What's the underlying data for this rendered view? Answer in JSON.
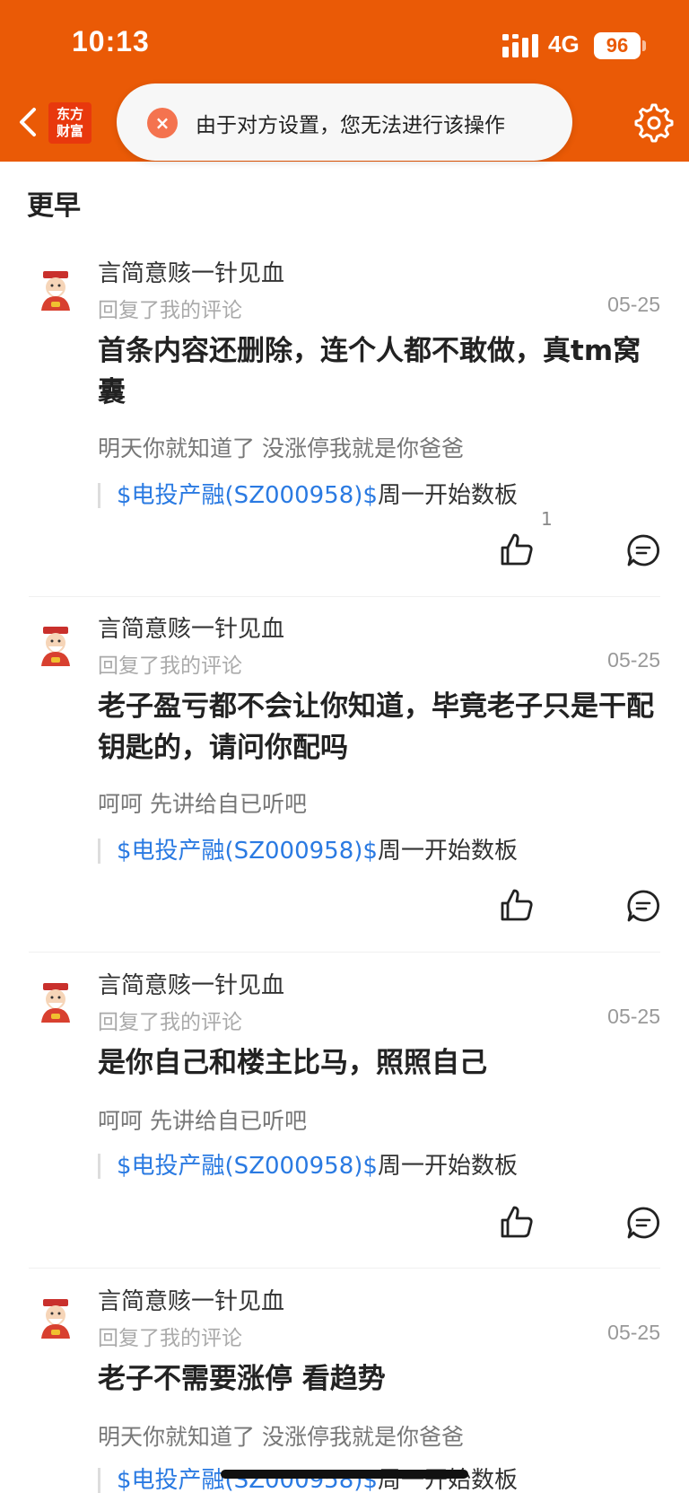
{
  "status_bar": {
    "time": "10:13",
    "network": "4G",
    "battery": "96"
  },
  "header": {
    "logo_line1": "东方",
    "logo_line2": "财富",
    "toast_text": "由于对方设置，您无法进行该操作"
  },
  "section_title": "更早",
  "items": [
    {
      "author": "言简意赅一针见血",
      "action": "回复了我的评论",
      "date": "05-25",
      "content": "首条内容还删除，连个人都不敢做，真tm窝囊",
      "quote": "明天你就知道了 没涨停我就是你爸爸",
      "stock_link": "$电投产融(SZ000958)$",
      "stock_text": "周一开始数板",
      "likes": "1"
    },
    {
      "author": "言简意赅一针见血",
      "action": "回复了我的评论",
      "date": "05-25",
      "content": "老子盈亏都不会让你知道，毕竟老子只是干配钥匙的，请问你配吗",
      "quote": "呵呵 先讲给自已听吧",
      "stock_link": "$电投产融(SZ000958)$",
      "stock_text": "周一开始数板",
      "likes": ""
    },
    {
      "author": "言简意赅一针见血",
      "action": "回复了我的评论",
      "date": "05-25",
      "content": "是你自己和楼主比马，照照自己",
      "quote": "呵呵 先讲给自已听吧",
      "stock_link": "$电投产融(SZ000958)$",
      "stock_text": "周一开始数板",
      "likes": ""
    },
    {
      "author": "言简意赅一针见血",
      "action": "回复了我的评论",
      "date": "05-25",
      "content": "老子不需要涨停 看趋势",
      "quote": "明天你就知道了 没涨停我就是你爸爸",
      "stock_link": "$电投产融(SZ000958)$",
      "stock_text": "周一开始数板",
      "likes": ""
    }
  ]
}
